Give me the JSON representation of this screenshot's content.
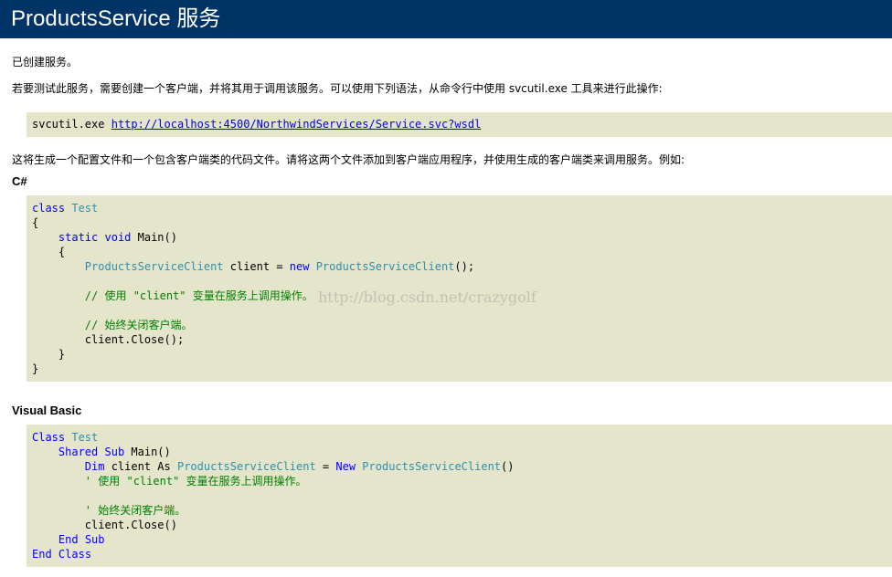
{
  "header": {
    "title": "ProductsService 服务"
  },
  "intro": {
    "created": "已创建服务。",
    "instructions": "若要测试此服务，需要创建一个客户端，并将其用于调用该服务。可以使用下列语法，从命令行中使用 svcutil.exe 工具来进行此操作:"
  },
  "svcutil": {
    "command": "svcutil.exe",
    "url": "http://localhost:4500/NorthwindServices/Service.svc?wsdl"
  },
  "generate_note": "这将生成一个配置文件和一个包含客户端类的代码文件。请将这两个文件添加到客户端应用程序，并使用生成的客户端类来调用服务。例如:",
  "csharp": {
    "label": "C#",
    "lines": [
      [
        {
          "t": "class",
          "c": "kw"
        },
        {
          "t": " "
        },
        {
          "t": "Test",
          "c": "ty"
        }
      ],
      [
        {
          "t": "{"
        }
      ],
      [
        {
          "t": "    "
        },
        {
          "t": "static",
          "c": "kw"
        },
        {
          "t": " "
        },
        {
          "t": "void",
          "c": "kw"
        },
        {
          "t": " Main()"
        }
      ],
      [
        {
          "t": "    {"
        }
      ],
      [
        {
          "t": "        "
        },
        {
          "t": "ProductsServiceClient",
          "c": "ty"
        },
        {
          "t": " client = "
        },
        {
          "t": "new",
          "c": "kw"
        },
        {
          "t": " "
        },
        {
          "t": "ProductsServiceClient",
          "c": "ty"
        },
        {
          "t": "();"
        }
      ],
      [
        {
          "t": ""
        }
      ],
      [
        {
          "t": "        "
        },
        {
          "t": "// 使用 \"client\" 变量在服务上调用操作。",
          "c": "cm"
        }
      ],
      [
        {
          "t": ""
        }
      ],
      [
        {
          "t": "        "
        },
        {
          "t": "// 始终关闭客户端。",
          "c": "cm"
        }
      ],
      [
        {
          "t": "        client.Close();"
        }
      ],
      [
        {
          "t": "    }"
        }
      ],
      [
        {
          "t": "}"
        }
      ]
    ]
  },
  "vb": {
    "label": "Visual Basic",
    "lines": [
      [
        {
          "t": "Class",
          "c": "kw"
        },
        {
          "t": " "
        },
        {
          "t": "Test",
          "c": "ty"
        }
      ],
      [
        {
          "t": "    "
        },
        {
          "t": "Shared",
          "c": "kw"
        },
        {
          "t": " "
        },
        {
          "t": "Sub",
          "c": "kw"
        },
        {
          "t": " Main()"
        }
      ],
      [
        {
          "t": "        "
        },
        {
          "t": "Dim",
          "c": "kw"
        },
        {
          "t": " client As "
        },
        {
          "t": "ProductsServiceClient",
          "c": "ty"
        },
        {
          "t": " = "
        },
        {
          "t": "New",
          "c": "kw"
        },
        {
          "t": " "
        },
        {
          "t": "ProductsServiceClient",
          "c": "ty"
        },
        {
          "t": "()"
        }
      ],
      [
        {
          "t": "        "
        },
        {
          "t": "' 使用 \"client\" 变量在服务上调用操作。",
          "c": "cm"
        }
      ],
      [
        {
          "t": ""
        }
      ],
      [
        {
          "t": "        "
        },
        {
          "t": "' 始终关闭客户端。",
          "c": "cm"
        }
      ],
      [
        {
          "t": "        client.Close()"
        }
      ],
      [
        {
          "t": "    "
        },
        {
          "t": "End",
          "c": "kw"
        },
        {
          "t": " "
        },
        {
          "t": "Sub",
          "c": "kw"
        }
      ],
      [
        {
          "t": "End",
          "c": "kw"
        },
        {
          "t": " "
        },
        {
          "t": "Class",
          "c": "kw"
        }
      ]
    ]
  },
  "watermark": "http://blog.csdn.net/crazygolf",
  "colors": {
    "header_bg": "#003366",
    "code_bg": "#e5e5cc",
    "keyword": "#0000ff",
    "type": "#2b91af",
    "comment": "#008000"
  }
}
